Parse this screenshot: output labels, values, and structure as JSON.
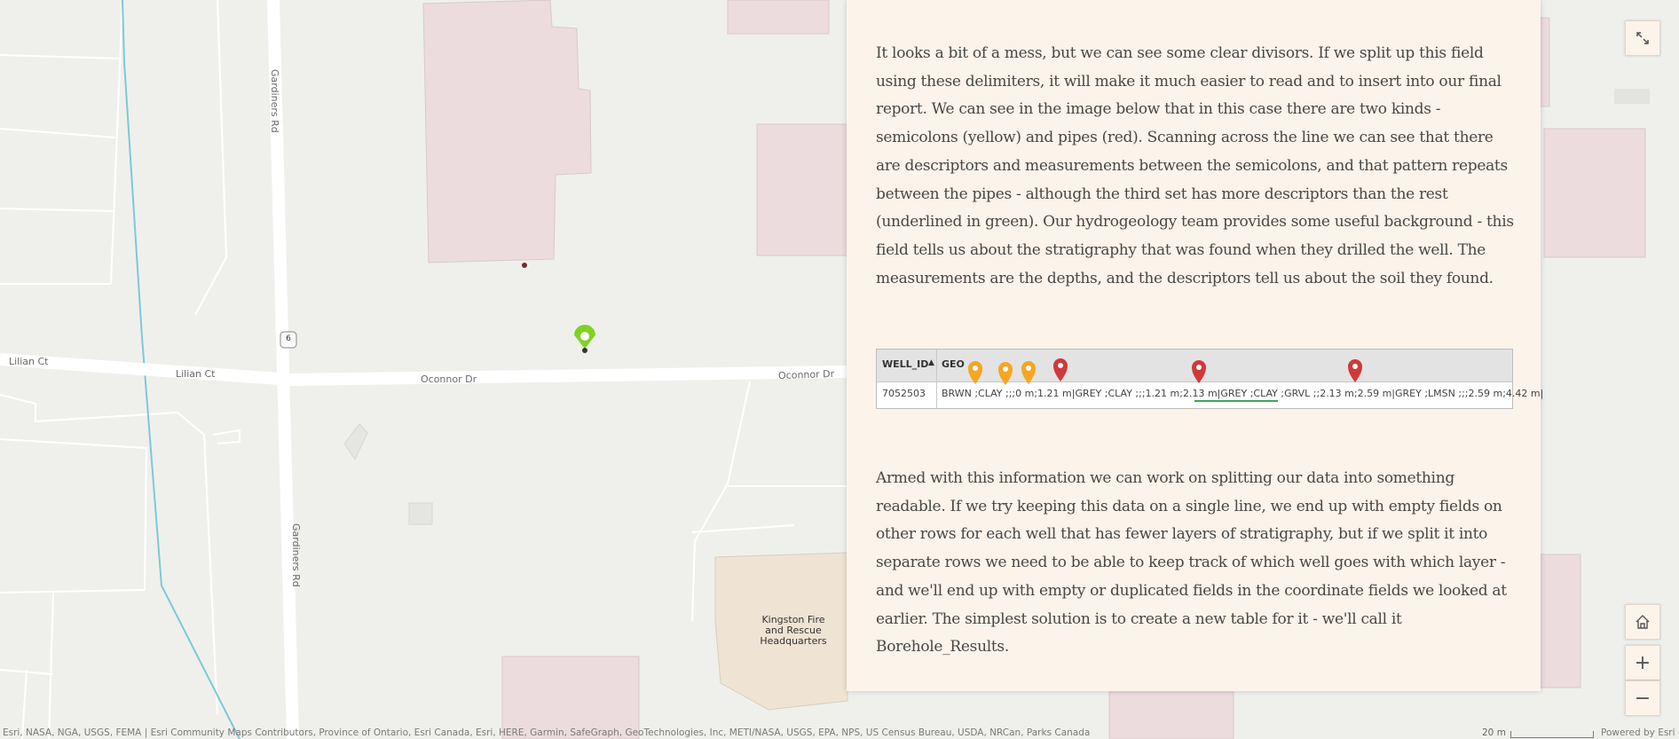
{
  "map": {
    "street_labels": {
      "gardiners_top": "Gardiners Rd",
      "gardiners_bottom": "Gardiners Rd",
      "lilian_ct_1": "Lilian Ct",
      "lilian_ct_2": "Lilian Ct",
      "oconnor_1": "Oconnor Dr",
      "oconnor_2": "Oconnor Dr",
      "route_shield": "6"
    },
    "poi_label": "Kingston Fire and Rescue Headquarters",
    "attribution": "Esri, NASA, NGA, USGS, FEMA | Esri Community Maps Contributors, Province of Ontario, Esri Canada, Esri, HERE, Garmin, SafeGraph, GeoTechnologies, Inc, METI/NASA, USGS, EPA, NPS, US Census Bureau, USDA, NRCan, Parks Canada",
    "scale_label": "20 m",
    "powered_by": "Powered by Esri",
    "marker_color": "#7ed321"
  },
  "panel": {
    "paragraph1": "It looks a bit of a mess, but we can see some clear divisors. If we split up this field using these delimiters, it will make it much easier to read and to insert into our final report. We can see in the image below that in this case there are two kinds - semicolons (yellow) and pipes (red). Scanning across the line we can see that there are descriptors and measurements between the semicolons, and that pattern repeats between the pipes - although the third set has more descriptors than the rest (underlined in green). Our hydrogeology team provides some useful background - this field tells us about the stratigraphy that was found when they drilled the well. The measurements are the depths, and the descriptors tell us about the soil they found.",
    "figure": {
      "col_well_id": "WELL_ID",
      "col_geo": "GEO",
      "row_id": "7052503",
      "row_geo": "BRWN ;CLAY ;;;0 m;1.21 m|GREY ;CLAY ;;;1.21 m;2.13 m|GREY ;CLAY ;GRVL ;;2.13 m;2.59 m|GREY ;LMSN ;;;2.59 m;4.42 m|",
      "semicolon_pin_color": "#f5a623",
      "pipe_pin_color": "#d0393b",
      "underline_color": "#3aa655"
    },
    "paragraph2": "Armed with this information we can work on splitting our data into something readable. If we try keeping this data on a single line, we end up with empty fields on other rows for each well that has fewer layers of stratigraphy, but if we split it into separate rows we need to be able to keep track of which well goes with which layer - and we'll end up with empty or duplicated fields in the coordinate fields we looked at earlier. The simplest solution is to create a new table for it - we'll call it Borehole_Results."
  },
  "controls": {
    "expand_icon": "expand-icon",
    "home_icon": "home-icon",
    "zoom_in": "+",
    "zoom_out": "−"
  }
}
